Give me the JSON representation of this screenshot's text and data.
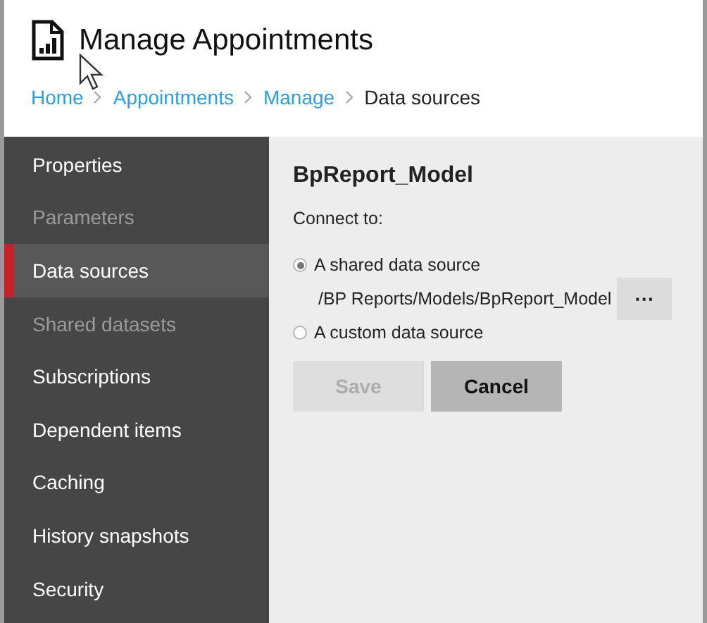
{
  "header": {
    "title": "Manage Appointments"
  },
  "breadcrumb": [
    {
      "label": "Home",
      "kind": "link"
    },
    {
      "label": "Appointments",
      "kind": "link"
    },
    {
      "label": "Manage",
      "kind": "link"
    },
    {
      "label": "Data sources",
      "kind": "current"
    }
  ],
  "sidebar": {
    "items": [
      {
        "label": "Properties",
        "selected": false,
        "disabled": false
      },
      {
        "label": "Parameters",
        "selected": false,
        "disabled": true
      },
      {
        "label": "Data sources",
        "selected": true,
        "disabled": false
      },
      {
        "label": "Shared datasets",
        "selected": false,
        "disabled": true
      },
      {
        "label": "Subscriptions",
        "selected": false,
        "disabled": false
      },
      {
        "label": "Dependent items",
        "selected": false,
        "disabled": false
      },
      {
        "label": "Caching",
        "selected": false,
        "disabled": false
      },
      {
        "label": "History snapshots",
        "selected": false,
        "disabled": false
      },
      {
        "label": "Security",
        "selected": false,
        "disabled": false
      }
    ]
  },
  "panel": {
    "title": "BpReport_Model",
    "connect_label": "Connect to:",
    "options": [
      {
        "label": "A shared data source",
        "selected": true,
        "path": "/BP Reports/Models/BpReport_Model",
        "browse": "···"
      },
      {
        "label": "A custom data source",
        "selected": false
      }
    ],
    "buttons": [
      {
        "label": "Save",
        "disabled": true
      },
      {
        "label": "Cancel",
        "disabled": false
      }
    ]
  }
}
